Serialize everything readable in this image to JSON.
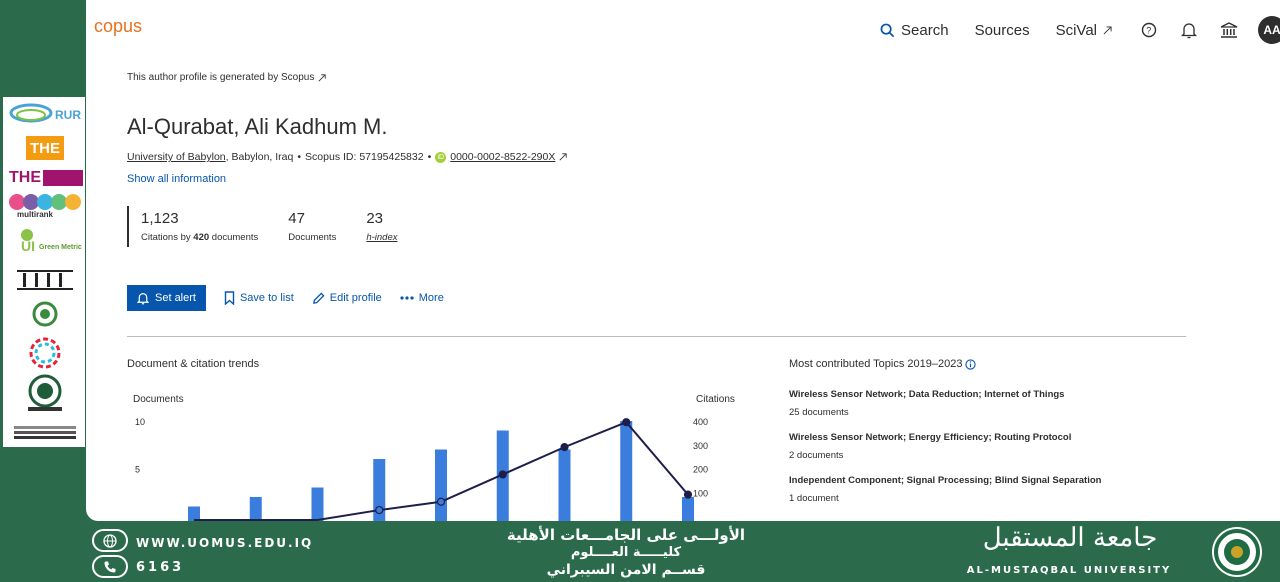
{
  "brand": {
    "text": "copus",
    "color": "#e9711c"
  },
  "nav": {
    "search": "Search",
    "sources": "Sources",
    "scival": "SciVal",
    "avatar": "AA"
  },
  "profile": {
    "generated_note": "This author profile is generated by Scopus",
    "name": "Al-Qurabat, Ali Kadhum M.",
    "university": "University of Babylon",
    "location": ", Babylon, Iraq",
    "scopus_id": "Scopus ID: 57195425832",
    "orcid": "0000-0002-8522-290X",
    "show_all": "Show all information"
  },
  "metrics": [
    {
      "value": "1,123",
      "label_pre": "Citations by ",
      "label_bold": "420",
      "label_post": " documents"
    },
    {
      "value": "47",
      "label": "Documents"
    },
    {
      "value": "23",
      "label": "h-index"
    }
  ],
  "actions": {
    "set_alert": "Set alert",
    "save_to_list": "Save to list",
    "edit_profile": "Edit profile",
    "more": "More"
  },
  "trends": {
    "title": "Document & citation trends"
  },
  "chart_data": {
    "type": "bar",
    "left_axis_label": "Documents",
    "right_axis_label": "Citations",
    "left_ticks": [
      "10",
      "5"
    ],
    "right_ticks": [
      "400",
      "300",
      "200",
      "100"
    ],
    "ylim_documents": [
      0,
      10
    ],
    "ylim_citations": [
      0,
      400
    ],
    "series": [
      {
        "name": "Documents",
        "type": "bar",
        "values": [
          1,
          2,
          3,
          6,
          7,
          9,
          7,
          10,
          2
        ]
      },
      {
        "name": "Citations",
        "type": "line",
        "values": [
          0,
          0,
          0,
          25,
          60,
          175,
          290,
          395,
          90
        ]
      }
    ],
    "colors": {
      "bars": "#3b7ddd",
      "line": "#1e1e4b"
    }
  },
  "topics": {
    "title": "Most contributed Topics 2019–2023",
    "items": [
      {
        "name": "Wireless Sensor Network; Data Reduction; Internet of Things",
        "count": "25 documents"
      },
      {
        "name": "Wireless Sensor Network; Energy Efficiency; Routing Protocol",
        "count": "2 documents"
      },
      {
        "name": "Independent Component; Signal Processing; Blind Signal Separation",
        "count": "1 document"
      }
    ]
  },
  "sidebar_logos": [
    {
      "name": "RUR"
    },
    {
      "name": "THE"
    },
    {
      "name": "THE"
    },
    {
      "name": "multirank"
    },
    {
      "name": "Green Metric"
    }
  ],
  "footer": {
    "website": "WWW.UOMUS.EDU.IQ",
    "phone": "6163",
    "arabic_line1": "الأولـــى على الجامـــعات الأهلية",
    "arabic_line2": "كليـــــة العــــلوم",
    "arabic_line3": "قســم الامن السيبراني",
    "uni_arabic": "جامعة المستقبل",
    "uni_english": "AL-MUSTAQBAL UNIVERSITY",
    "bg_color": "#2b6b4c"
  }
}
